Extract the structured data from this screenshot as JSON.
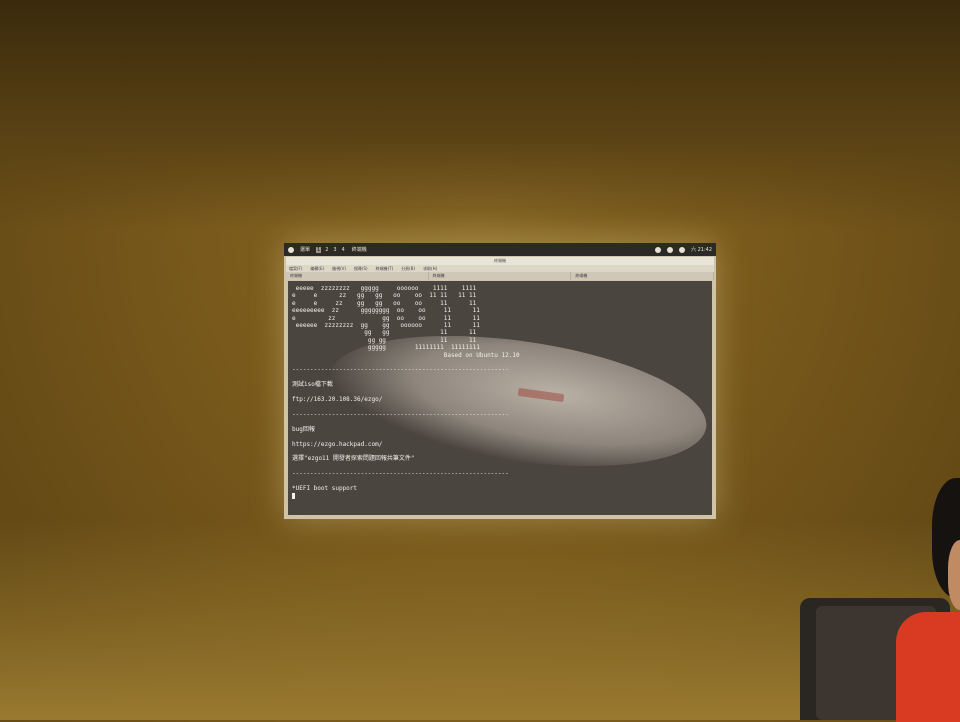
{
  "topbar": {
    "workspaces": [
      "1",
      "2",
      "3",
      "4"
    ],
    "active_workspace": "1",
    "menu_label": "選單",
    "app_label": "終端機",
    "clock": "六 21:42"
  },
  "window": {
    "title": "終端機",
    "menus": [
      "檔案(F)",
      "編輯(E)",
      "檢視(V)",
      "搜尋(S)",
      "終端機(T)",
      "分頁(B)",
      "求助(H)"
    ],
    "tabs": [
      "終端機",
      "終端機",
      "終端機"
    ]
  },
  "terminal": {
    "ascii_art": [
      " eeeee  zzzzzzzz   ggggg     oooooo    1111    1111",
      "e     e      zz   gg   gg   oo    oo  11 11   11 11",
      "e     e     zz    gg   gg   oo    oo     11      11",
      "eeeeeeeee  zz      gggggggg  oo    oo     11      11",
      "e         zz             gg  oo    oo     11      11",
      " eeeeee  zzzzzzzz  gg    gg   oooooo      11      11",
      "                    gg   gg              11      11",
      "                     gg gg               11      11",
      "                     ggggg        11111111  11111111"
    ],
    "based_on": "Based on Ubuntu 12.10",
    "divider": "------------------------------------------------------------",
    "iso_title": "測試iso檔下載",
    "iso_url": "ftp://163.20.108.36/ezgo/",
    "bug_title": "bug回報",
    "bug_url": "https://ezgo.hackpad.com/",
    "bug_hint": "選擇\"ezgo11 開發者探索問題回報共筆文件\"",
    "uefi": "*UEFI boot support"
  }
}
